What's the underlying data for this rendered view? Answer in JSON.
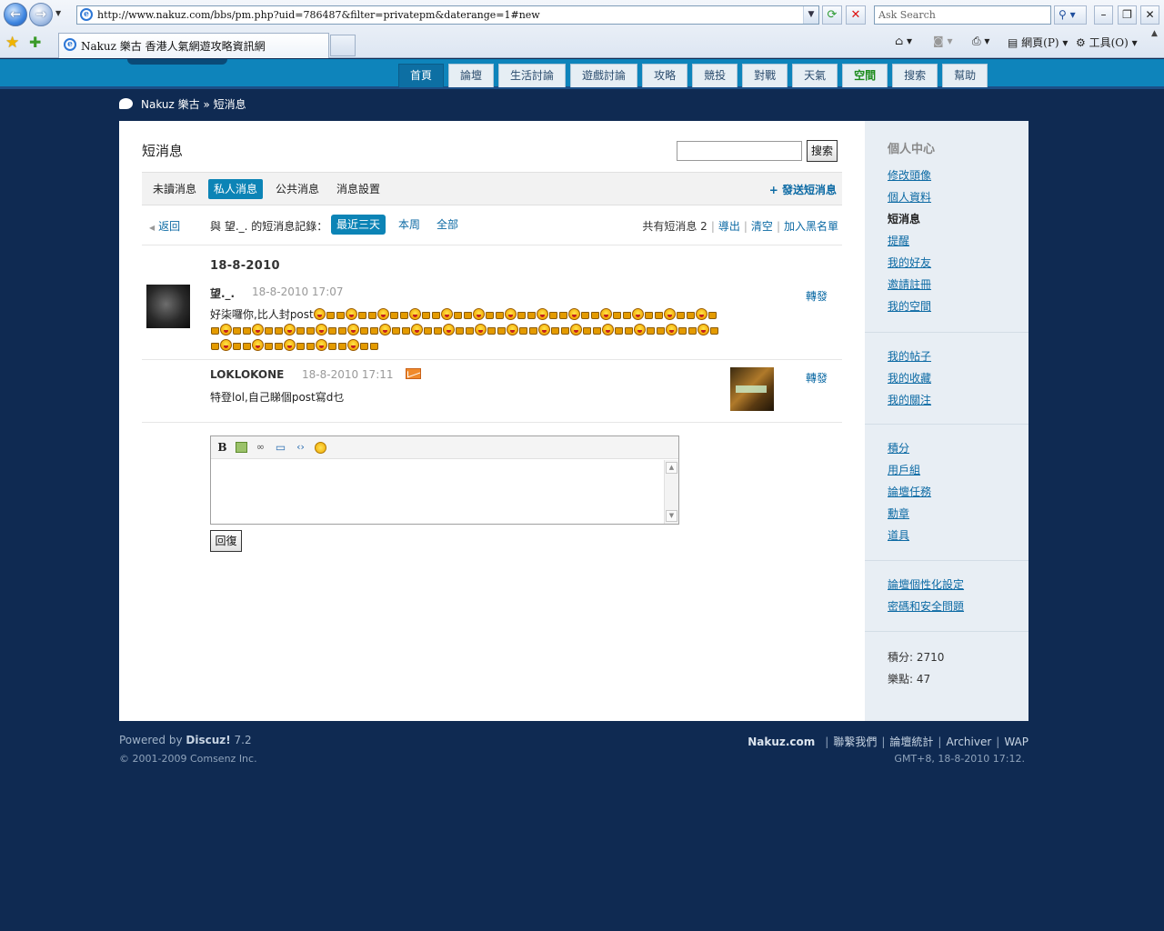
{
  "browser": {
    "url": "http://www.nakuz.com/bbs/pm.php?uid=786487&filter=privatepm&daterange=1#new",
    "search_placeholder": "Ask Search",
    "tab_title": "Nakuz 樂古 香港人氣網遊攻略資訊網",
    "commands": {
      "page": "網頁(P)",
      "tools": "工具(O)"
    },
    "icons": {
      "back": "back-arrow-icon",
      "forward": "forward-arrow-icon",
      "refresh": "refresh-icon",
      "stop": "stop-icon",
      "favorites": "star-icon",
      "home": "home-icon",
      "feeds": "rss-icon",
      "print": "printer-icon"
    }
  },
  "nav": {
    "items": [
      "首頁",
      "論壇",
      "生活討論",
      "遊戲討論",
      "攻略",
      "競投",
      "對戰",
      "天氣",
      "空間",
      "搜索",
      "幫助"
    ],
    "active_index": 0,
    "highlight_index": 8
  },
  "breadcrumb": "Nakuz 樂古 » 短消息",
  "main": {
    "title": "短消息",
    "search_button": "搜索",
    "type_tabs": [
      "未讀消息",
      "私人消息",
      "公共消息",
      "消息設置"
    ],
    "active_type_index": 1,
    "send_link": "+ 發送短消息",
    "back_link": "返回",
    "history_label": "與 望._. 的短消息記錄：",
    "range_tabs": [
      "最近三天",
      "本周",
      "全部"
    ],
    "active_range_index": 0,
    "count_label": "共有短消息 2",
    "actions": [
      "導出",
      "清空",
      "加入黑名單"
    ],
    "date_heading": "18-8-2010",
    "messages": [
      {
        "author": "望._.",
        "time": "18-8-2010 17:07",
        "text": "好柒囉你,比人封post",
        "forward": "轉發",
        "emoticon_count": 34
      },
      {
        "author": "LOKLOKONE",
        "time": "18-8-2010 17:11",
        "text": "特登lol,自己睇個post寫d乜",
        "forward": "轉發"
      }
    ],
    "editor_toolbar": [
      "bold",
      "image",
      "link",
      "quote",
      "code",
      "smiley"
    ],
    "reply_button": "回復"
  },
  "sidebar": {
    "title": "個人中心",
    "group1": [
      "修改頭像",
      "個人資料",
      "短消息",
      "提醒",
      "我的好友",
      "邀請註冊",
      "我的空間"
    ],
    "current": "短消息",
    "group2": [
      "我的帖子",
      "我的收藏",
      "我的關注"
    ],
    "group3": [
      "積分",
      "用戶組",
      "論壇任務",
      "勳章",
      "道具"
    ],
    "group4": [
      "論壇個性化設定",
      "密碼和安全問題"
    ],
    "stats": [
      "積分: 2710",
      "樂點: 47"
    ]
  },
  "footer": {
    "powered_prefix": "Powered by ",
    "powered_name": "Discuz!",
    "powered_version": " 7.2",
    "copyright": "© 2001-2009 Comsenz Inc.",
    "site": "Nakuz.com",
    "links": [
      "聯繫我們",
      "論壇統計",
      "Archiver",
      "WAP"
    ],
    "time": "GMT+8, 18-8-2010 17:12."
  }
}
